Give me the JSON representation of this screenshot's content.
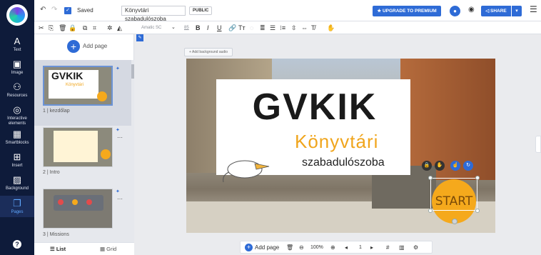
{
  "colors": {
    "accent": "#2e6bd6",
    "rail_bg": "#0e1b3a",
    "brand_orange": "#f5a91c"
  },
  "topbar": {
    "undo_icon": "undo-icon",
    "redo_icon": "redo-icon",
    "saved_label": "Saved",
    "doc_title": "Könyvtári szabadulószoba",
    "visibility_label": "PUBLIC",
    "upgrade_label": "UPGRADE TO PREMIUM",
    "share_label": "SHARE"
  },
  "format": {
    "font_name": "Amatic SC",
    "font_size": "85",
    "bold": "B",
    "italic": "I",
    "underline": "U"
  },
  "rail": {
    "items": [
      {
        "icon": "A",
        "label": "Text"
      },
      {
        "icon": "▣",
        "label": "Image"
      },
      {
        "icon": "⚇",
        "label": "Resources"
      },
      {
        "icon": "◎",
        "label": "Interactive elements"
      },
      {
        "icon": "▦",
        "label": "Smartblocks"
      },
      {
        "icon": "⊞",
        "label": "Insert"
      },
      {
        "icon": "▨",
        "label": "Background"
      },
      {
        "icon": "❐",
        "label": "Pages"
      }
    ]
  },
  "panel": {
    "add_page_label": "Add page",
    "pages": [
      {
        "label": "1 | kezdőlap"
      },
      {
        "label": "2 | Intro"
      },
      {
        "label": "3 | Missions"
      }
    ],
    "list_tab": "List",
    "grid_tab": "Grid"
  },
  "canvas": {
    "add_bg_audio": "Add background audio",
    "title_main": "GVKIK",
    "title_sub1": "Könyvtári",
    "title_sub2": "szabadulószoba",
    "start_label": "START"
  },
  "bottombar": {
    "add_page_label": "Add page",
    "zoom": "100%",
    "page_number": "1"
  }
}
